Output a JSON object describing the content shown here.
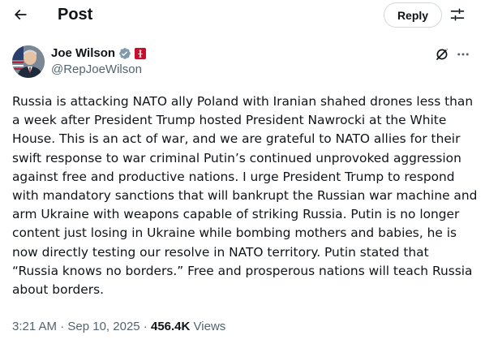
{
  "header": {
    "title": "Post",
    "reply_label": "Reply"
  },
  "icons": {
    "back": "back-arrow-icon",
    "filter": "sliders-icon",
    "verified": "verified-badge-icon",
    "affiliation": "government-affiliation-icon",
    "grok": "grok-icon",
    "more": "more-icon"
  },
  "post": {
    "author": {
      "name": "Joe Wilson",
      "handle": "@RepJoeWilson"
    },
    "text": "Russia is attacking NATO ally Poland with Iranian shahed drones less than a week after President Trump hosted President Nawrocki at the White House. This is an act of war, and we are grateful to NATO allies for their swift response to war criminal Putin’s continued unprovoked aggression against free and productive nations. I urge President Trump to respond with mandatory sanctions that will bankrupt the Russian war machine and arm Ukraine with weapons capable of striking Russia. Putin is no longer content just losing in Ukraine while bombing mothers and babies, he is now directly testing our resolve in NATO territory. Putin stated that “Russia knows no borders.” Free and prosperous nations will teach Russia about borders.",
    "time": "3:21 AM",
    "separator": " · ",
    "date": "Sep 10, 2025",
    "views_count": "456.4K",
    "views_label": "Views"
  },
  "colors": {
    "text_primary": "#0f1419",
    "text_secondary": "#536471",
    "verified_badge": "#829aab",
    "affiliation_badge": "#c8102e",
    "border": "#cfd9de"
  }
}
